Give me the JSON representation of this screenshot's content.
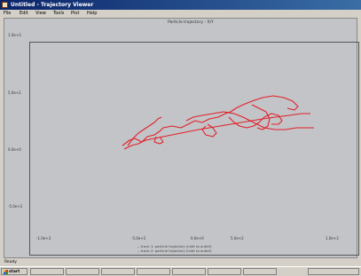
{
  "window": {
    "title": "Untitled - Trajectory Viewer",
    "menu": [
      "File",
      "Edit",
      "View",
      "Tools",
      "Plot",
      "Help"
    ]
  },
  "plot": {
    "title": "Particle trajectory - X/Y",
    "y_ticks": [
      "1.0e+3",
      "5.0e+2",
      "0.0e+0",
      "-5.0e+2"
    ],
    "x_ticks": [
      "-1.0e+3",
      "-5.0e+2",
      "0.0e+0",
      "5.0e+2",
      "1.0e+3"
    ],
    "legend": [
      "-- track 1: particle trajectory (inlet to outlet)",
      "-- track 2: particle trajectory (inlet to outlet)"
    ],
    "trace_color": "#e0202a"
  },
  "status": {
    "text": "Ready"
  },
  "taskbar": {
    "start_label": "start"
  }
}
